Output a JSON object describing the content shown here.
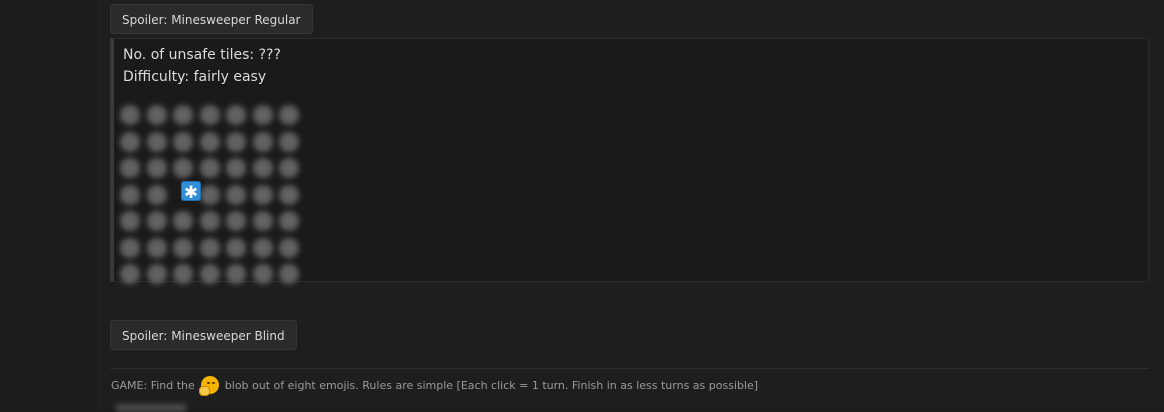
{
  "spoiler_regular": {
    "button_label": "Spoiler: Minesweeper Regular",
    "line1": "No. of unsafe tiles: ???",
    "line2": "Difficulty: fairly easy",
    "grid": {
      "rows": 7,
      "cols": 7,
      "state": "hidden",
      "revealed_tile": {
        "row": 4,
        "col": 3,
        "glyph": "✱"
      }
    }
  },
  "spoiler_blind": {
    "button_label": "Spoiler: Minesweeper Blind"
  },
  "game_line": {
    "prefix": "GAME: Find the",
    "emoji": "blob-emoji",
    "suffix": "blob out of eight emojis. Rules are simple [Each click = 1 turn. Finish in as less turns as possible]"
  },
  "colors": {
    "background": "#1e1e1e",
    "button_bg": "#2b2b2b",
    "revealed_tile": "#2f8fd8",
    "blob_emoji": "#f4b400"
  }
}
